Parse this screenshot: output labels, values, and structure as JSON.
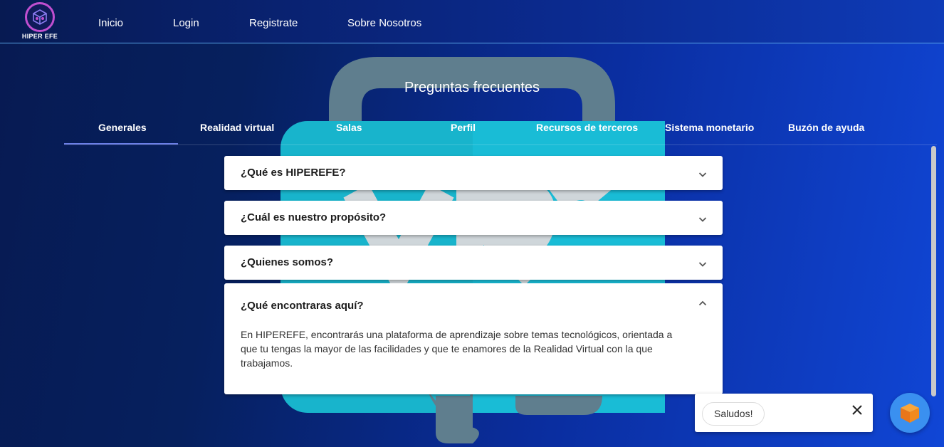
{
  "brand": {
    "logo_text": "HIPER EFE"
  },
  "nav": {
    "items": [
      "Inicio",
      "Login",
      "Registrate",
      "Sobre Nosotros"
    ]
  },
  "faq": {
    "title": "Preguntas frecuentes",
    "tabs": [
      "Generales",
      "Realidad virtual",
      "Salas",
      "Perfil",
      "Recursos de terceros",
      "Sistema monetario",
      "Buzón de ayuda"
    ],
    "active_tab": "Generales",
    "questions": [
      {
        "title": "¿Qué es HIPEREFE?",
        "expanded": false
      },
      {
        "title": "¿Cuál es nuestro propósito?",
        "expanded": false
      },
      {
        "title": "¿Quienes somos?",
        "expanded": false
      },
      {
        "title": "¿Qué encontraras aquí?",
        "expanded": true,
        "answer": "En HIPEREFE, encontrarás una plataforma de aprendizaje sobre temas tecnológicos, orientada a que tu tengas la mayor de las facilidades y que te enamores de la Realidad Virtual con la que trabajamos."
      }
    ]
  },
  "chat": {
    "message": "Saludos!",
    "icons": {
      "close": "close-icon",
      "launcher": "cube-icon"
    }
  },
  "colors": {
    "accent_indicator": "#6b7fe8",
    "chat_fab": "#3a90f0",
    "cube": "#f08a1c"
  }
}
